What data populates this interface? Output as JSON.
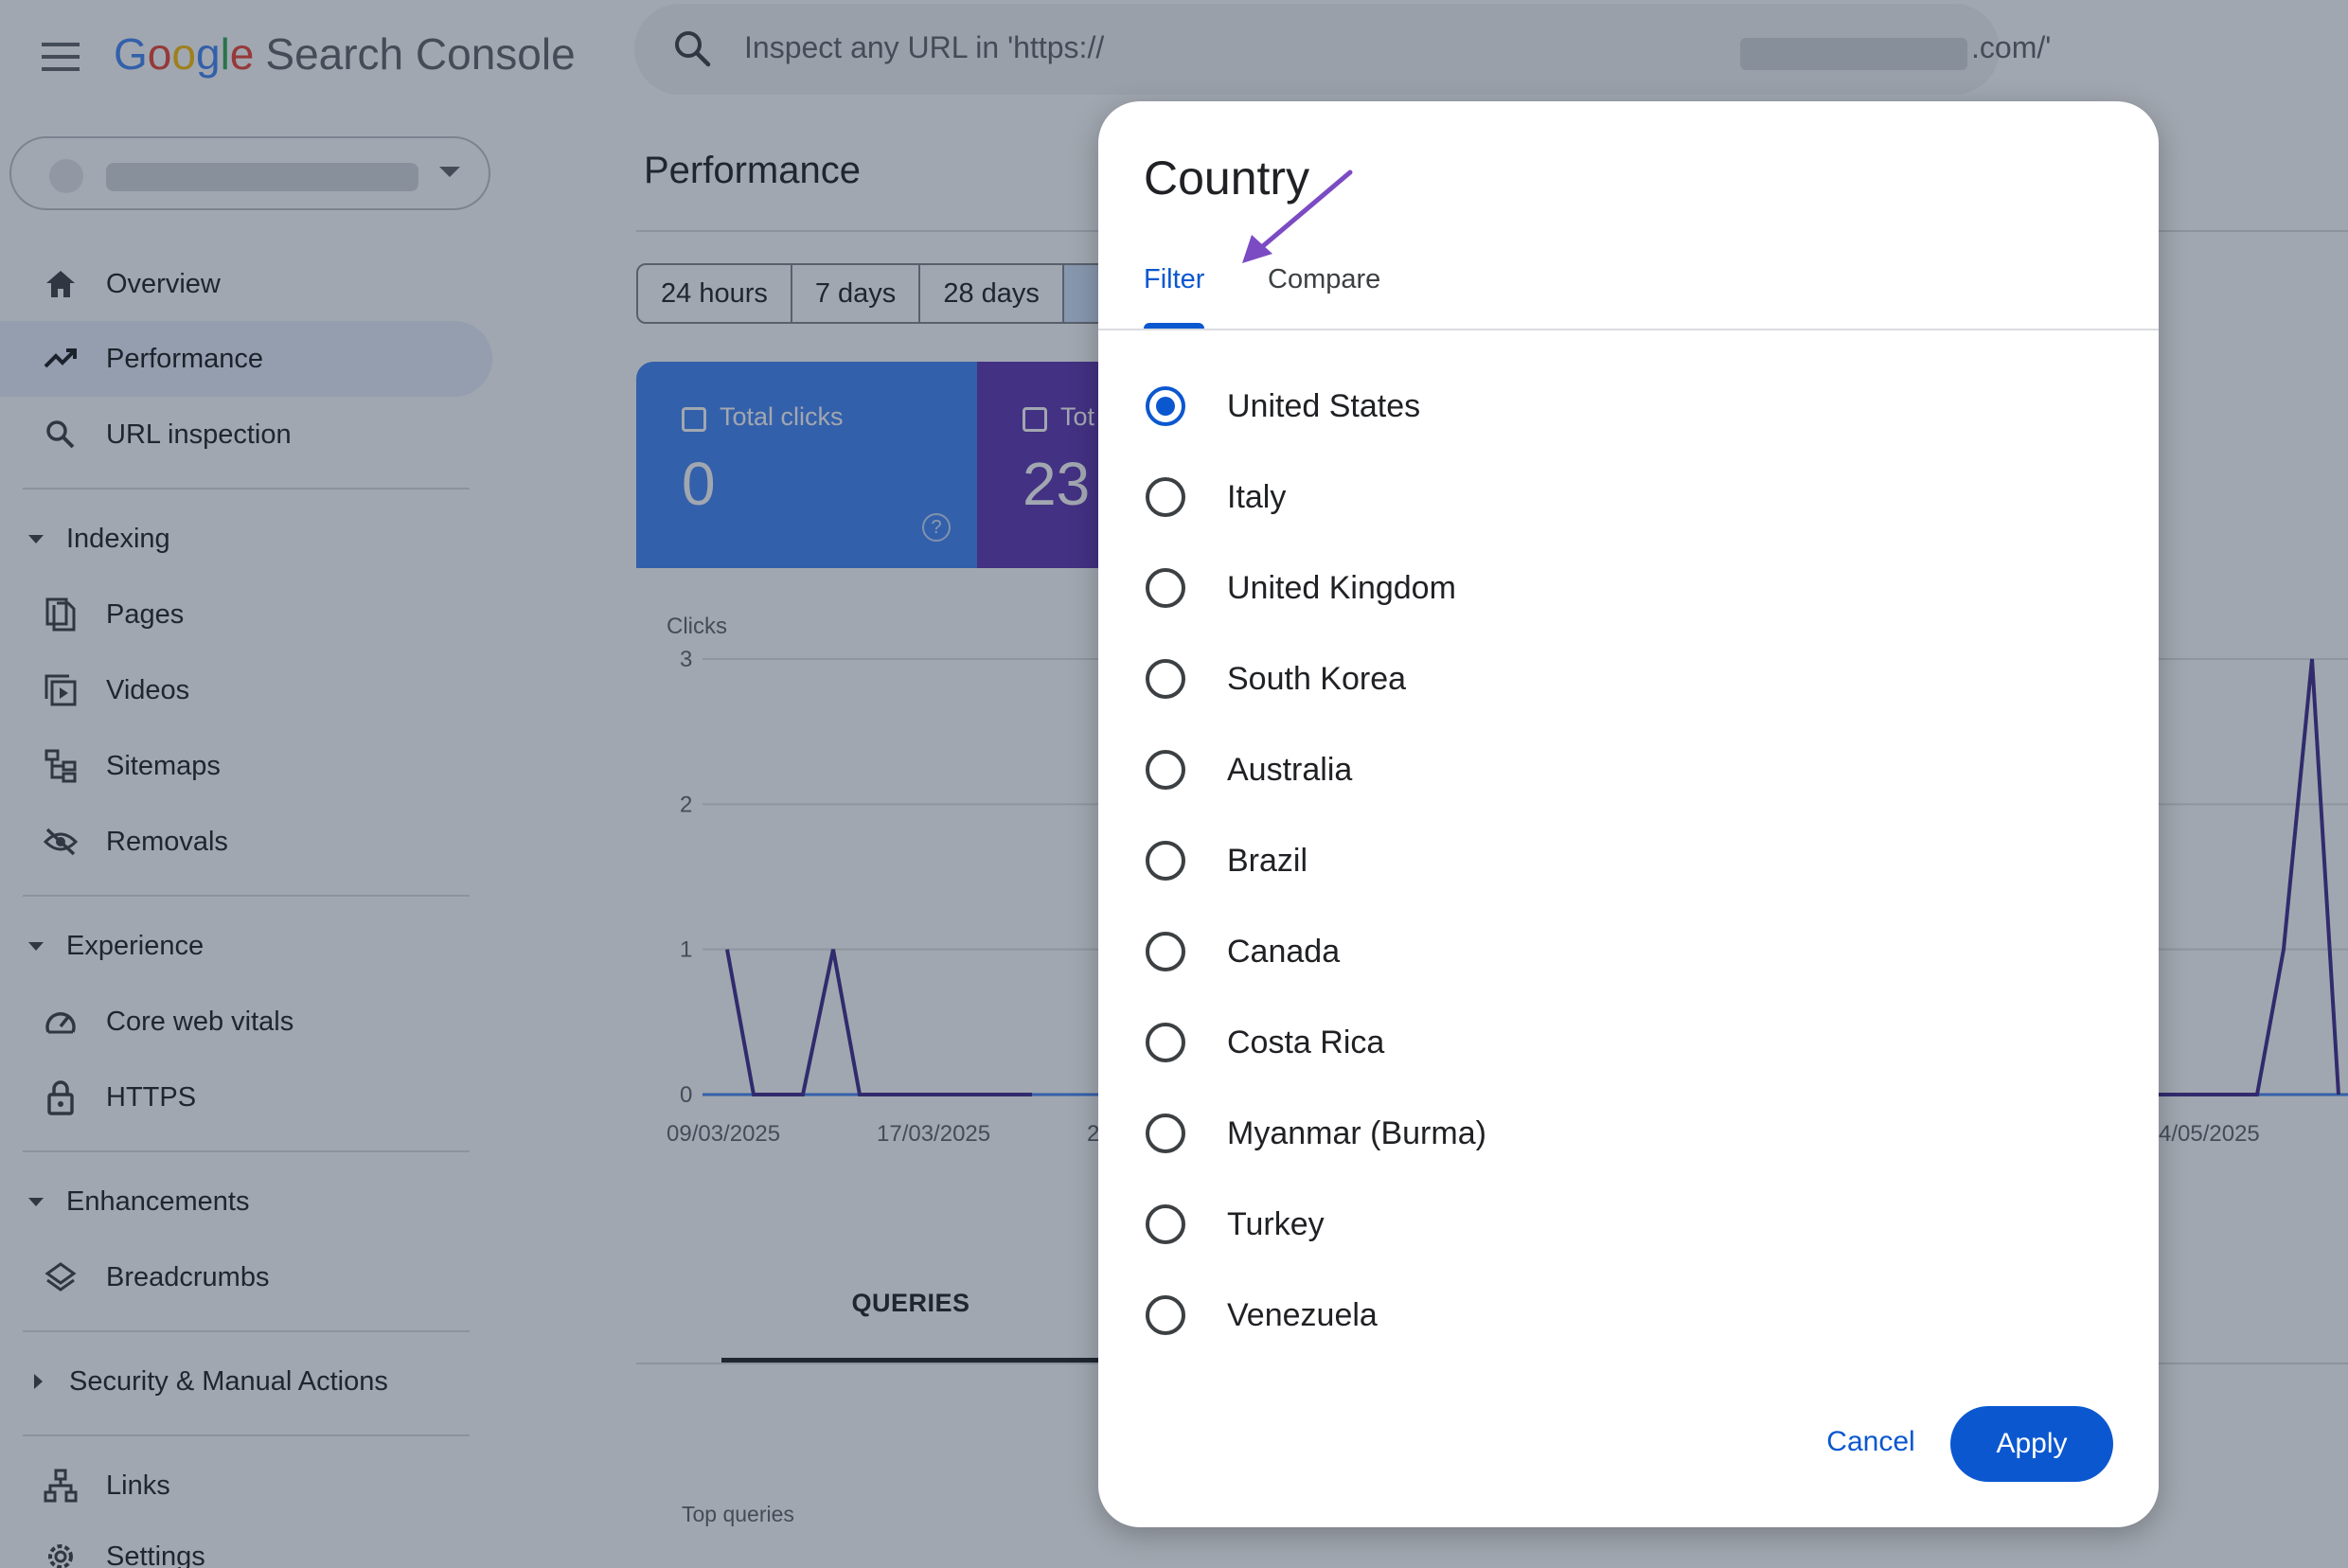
{
  "header": {
    "logo_google": [
      "G",
      "o",
      "o",
      "g",
      "l",
      "e"
    ],
    "logo_product": "Search Console",
    "search_placeholder_prefix": "Inspect any URL in 'https://",
    "search_placeholder_suffix": ".com/'"
  },
  "sidebar": {
    "items": [
      {
        "label": "Overview",
        "icon": "home-icon"
      },
      {
        "label": "Performance",
        "icon": "trending-up-icon",
        "active": true
      },
      {
        "label": "URL inspection",
        "icon": "search-icon"
      }
    ],
    "sections": [
      {
        "title": "Indexing",
        "items": [
          "Pages",
          "Videos",
          "Sitemaps",
          "Removals"
        ]
      },
      {
        "title": "Experience",
        "items": [
          "Core web vitals",
          "HTTPS"
        ]
      },
      {
        "title": "Enhancements",
        "items": [
          "Breadcrumbs"
        ]
      },
      {
        "title": "Security & Manual Actions",
        "items": []
      }
    ],
    "bottom_items": [
      "Links",
      "Settings"
    ]
  },
  "main": {
    "title": "Performance",
    "date_ranges": [
      "24 hours",
      "7 days",
      "28 days"
    ],
    "metrics": [
      {
        "label": "Total clicks",
        "value": "0"
      },
      {
        "label": "Tot",
        "value": "23"
      }
    ],
    "chart_label": "Clicks",
    "tabs": [
      "QUERIES"
    ],
    "top_queries_label": "Top queries"
  },
  "chart_data": {
    "type": "line",
    "title": "",
    "xlabel": "",
    "ylabel": "Clicks",
    "ylim": [
      0,
      3
    ],
    "yticks": [
      "3",
      "2",
      "1",
      "0"
    ],
    "xticks": [
      "09/03/2025",
      "17/03/2025",
      "2",
      "4/05/2025"
    ],
    "series": [
      {
        "values_left": [
          1,
          0,
          0,
          1,
          0,
          0,
          0
        ],
        "values_right": [
          0,
          0,
          1,
          3,
          0
        ]
      }
    ],
    "color": "#3f2a8c",
    "grid": true
  },
  "dialog": {
    "title": "Country",
    "tabs": {
      "filter": "Filter",
      "compare": "Compare"
    },
    "options": [
      "United States",
      "Italy",
      "United Kingdom",
      "South Korea",
      "Australia",
      "Brazil",
      "Canada",
      "Costa Rica",
      "Myanmar (Burma)",
      "Turkey",
      "Venezuela"
    ],
    "selected": "United States",
    "cancel_label": "Cancel",
    "apply_label": "Apply"
  },
  "colors": {
    "accent": "#0b57d0",
    "metric_blue": "#4285f4",
    "metric_purple": "#5e35b1",
    "annotation_arrow": "#7b4bc4"
  }
}
